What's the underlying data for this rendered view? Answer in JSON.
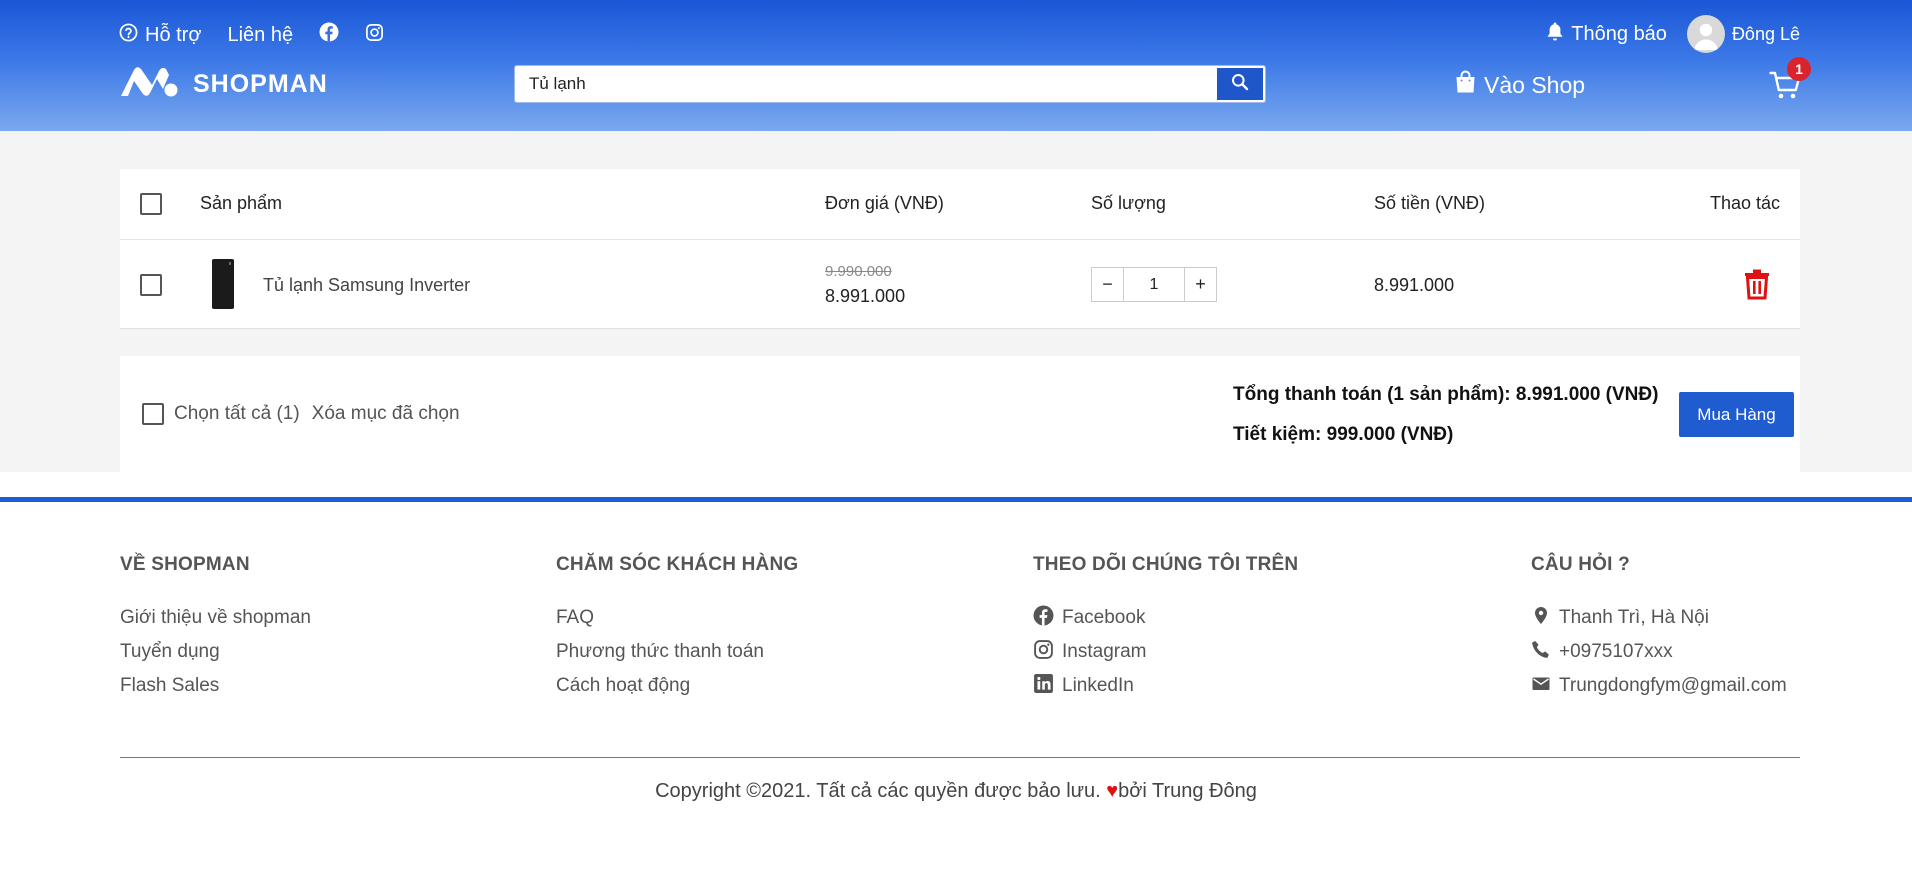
{
  "header": {
    "support_label": "Hỗ trợ",
    "contact_label": "Liên hệ",
    "notification_label": "Thông báo",
    "user_name": "Đông Lê",
    "logo_text": "SHOPMAN",
    "search": {
      "value": "Tủ lạnh",
      "placeholder": ""
    },
    "shop_label": "Vào Shop",
    "cart_count": "1"
  },
  "cart": {
    "columns": {
      "product": "Sản phẩm",
      "unit_price": "Đơn giá (VNĐ)",
      "quantity": "Số lượng",
      "amount": "Số tiền (VNĐ)",
      "actions": "Thao tác"
    },
    "items": [
      {
        "name": "Tủ lạnh Samsung Inverter",
        "old_price": "9.990.000",
        "price": "8.991.000",
        "quantity": "1",
        "subtotal": "8.991.000"
      }
    ],
    "qty_minus": "−",
    "qty_plus": "+"
  },
  "summary": {
    "select_all": "Chọn tất cả (1)",
    "delete_selected": "Xóa mục đã chọn",
    "total": "Tổng thanh toán (1 sản phẩm): 8.991.000 (VNĐ)",
    "savings": "Tiết kiệm: 999.000 (VNĐ)",
    "buy_button": "Mua Hàng"
  },
  "footer": {
    "about": {
      "title": "VỀ SHOPMAN",
      "links": [
        "Giới thiệu về shopman",
        "Tuyển dụng",
        "Flash Sales"
      ]
    },
    "care": {
      "title": "CHĂM SÓC KHÁCH HÀNG",
      "links": [
        "FAQ",
        "Phương thức thanh toán",
        "Cách hoạt động"
      ]
    },
    "follow": {
      "title": "THEO DÕI CHÚNG TÔI TRÊN",
      "links": [
        "Facebook",
        "Instagram",
        "LinkedIn"
      ]
    },
    "questions": {
      "title": "CÂU HỎI ?",
      "address": "Thanh Trì, Hà Nội",
      "phone": "+0975107xxx",
      "email": "Trungdongfym@gmail.com"
    },
    "copyright_prefix": "Copyright ©2021. Tất cả các quyền được bảo lưu.",
    "heart": "♥",
    "copyright_suffix": "bởi Trung Đông"
  },
  "colors": {
    "primary": "#1f5cd0",
    "header_top": "#1a56d6",
    "header_bottom": "#7aa9ef",
    "danger": "#e01111",
    "badge": "#d9232d"
  },
  "icons": [
    "question-circle-icon",
    "facebook-icon",
    "instagram-icon",
    "bell-icon",
    "user-avatar-icon",
    "logo-m-icon",
    "search-icon",
    "shopping-bag-icon",
    "cart-icon",
    "trash-icon",
    "map-pin-icon",
    "phone-icon",
    "mail-icon",
    "linkedin-icon"
  ]
}
